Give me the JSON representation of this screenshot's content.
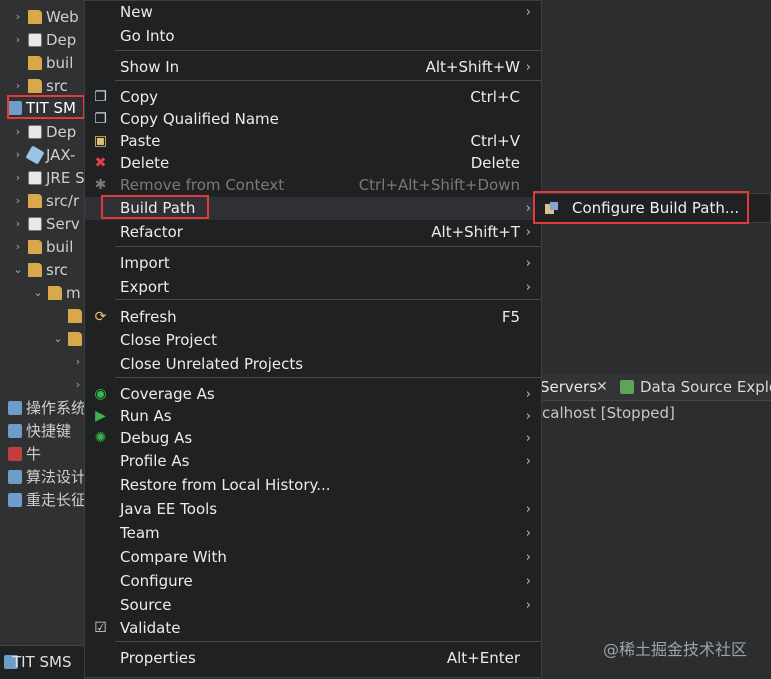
{
  "tree": {
    "items": [
      {
        "label": "Web",
        "arrow": "›",
        "icon": "folder-icon",
        "indent": 0
      },
      {
        "label": "Dep",
        "arrow": "›",
        "icon": "library-icon",
        "indent": 0
      },
      {
        "label": "buil",
        "arrow": "",
        "icon": "folder-icon",
        "indent": 0
      },
      {
        "label": "src",
        "arrow": "›",
        "icon": "folder-icon",
        "indent": 0
      },
      {
        "label": "TIT SM",
        "arrow": "⌄",
        "icon": "project-icon",
        "indent": -1,
        "selected": true
      },
      {
        "label": "Dep",
        "arrow": "›",
        "icon": "library-icon",
        "indent": 0
      },
      {
        "label": "JAX-",
        "arrow": "›",
        "icon": "jar-icon",
        "indent": 0
      },
      {
        "label": "JRE S",
        "arrow": "›",
        "icon": "library-icon",
        "indent": 0
      },
      {
        "label": "src/r",
        "arrow": "›",
        "icon": "folder-icon",
        "indent": 0
      },
      {
        "label": "Serv",
        "arrow": "›",
        "icon": "library-icon",
        "indent": 0
      },
      {
        "label": "buil",
        "arrow": "›",
        "icon": "folder-icon",
        "indent": 0
      },
      {
        "label": "src",
        "arrow": "⌄",
        "icon": "folder-icon",
        "indent": 0
      },
      {
        "label": "m",
        "arrow": "⌄",
        "icon": "folder-icon",
        "indent": 1
      },
      {
        "label": "",
        "arrow": "",
        "icon": "folder-icon",
        "indent": 2
      },
      {
        "label": "",
        "arrow": "⌄",
        "icon": "folder-icon",
        "indent": 2
      },
      {
        "label": "",
        "arrow": "›",
        "icon": "",
        "indent": 3
      },
      {
        "label": "",
        "arrow": "›",
        "icon": "",
        "indent": 3
      },
      {
        "label": "操作系统",
        "arrow": "›",
        "icon": "project-icon",
        "indent": -1
      },
      {
        "label": "快捷键",
        "arrow": "›",
        "icon": "project-icon",
        "indent": -1
      },
      {
        "label": "牛",
        "arrow": "›",
        "icon": "project-red-icon",
        "indent": -1
      },
      {
        "label": "算法设计",
        "arrow": "›",
        "icon": "project-icon",
        "indent": -1
      },
      {
        "label": "重走长征",
        "arrow": "›",
        "icon": "project-icon",
        "indent": -1
      }
    ]
  },
  "bottom_strip": {
    "label": "TIT SMS"
  },
  "context_menu": {
    "items": [
      {
        "label": "New",
        "shortcut": "",
        "submenu": true,
        "icon": ""
      },
      {
        "label": "Go Into",
        "shortcut": "",
        "submenu": false,
        "icon": ""
      },
      {
        "separator": true
      },
      {
        "label": "Show In",
        "shortcut": "Alt+Shift+W",
        "submenu": true,
        "icon": ""
      },
      {
        "separator": true
      },
      {
        "label": "Copy",
        "shortcut": "Ctrl+C",
        "submenu": false,
        "icon": "copy-icon"
      },
      {
        "label": "Copy Qualified Name",
        "shortcut": "",
        "submenu": false,
        "icon": "copy-qualified-icon"
      },
      {
        "label": "Paste",
        "shortcut": "Ctrl+V",
        "submenu": false,
        "icon": "paste-icon"
      },
      {
        "label": "Delete",
        "shortcut": "Delete",
        "submenu": false,
        "icon": "delete-icon"
      },
      {
        "label": "Remove from Context",
        "shortcut": "Ctrl+Alt+Shift+Down",
        "submenu": false,
        "icon": "remove-context-icon",
        "disabled": true
      },
      {
        "label": "Build Path",
        "shortcut": "",
        "submenu": true,
        "icon": "",
        "hover": true
      },
      {
        "label": "Refactor",
        "shortcut": "Alt+Shift+T",
        "submenu": true,
        "icon": ""
      },
      {
        "separator": true
      },
      {
        "label": "Import",
        "shortcut": "",
        "submenu": true,
        "icon": ""
      },
      {
        "label": "Export",
        "shortcut": "",
        "submenu": true,
        "icon": ""
      },
      {
        "separator": true
      },
      {
        "label": "Refresh",
        "shortcut": "F5",
        "submenu": false,
        "icon": "refresh-icon"
      },
      {
        "label": "Close Project",
        "shortcut": "",
        "submenu": false,
        "icon": ""
      },
      {
        "label": "Close Unrelated Projects",
        "shortcut": "",
        "submenu": false,
        "icon": ""
      },
      {
        "separator": true
      },
      {
        "label": "Coverage As",
        "shortcut": "",
        "submenu": true,
        "icon": "coverage-icon"
      },
      {
        "label": "Run As",
        "shortcut": "",
        "submenu": true,
        "icon": "run-icon"
      },
      {
        "label": "Debug As",
        "shortcut": "",
        "submenu": true,
        "icon": "debug-icon"
      },
      {
        "label": "Profile As",
        "shortcut": "",
        "submenu": true,
        "icon": ""
      },
      {
        "label": "Restore from Local History...",
        "shortcut": "",
        "submenu": false,
        "icon": ""
      },
      {
        "label": "Java EE Tools",
        "shortcut": "",
        "submenu": true,
        "icon": ""
      },
      {
        "label": "Team",
        "shortcut": "",
        "submenu": true,
        "icon": ""
      },
      {
        "label": "Compare With",
        "shortcut": "",
        "submenu": true,
        "icon": ""
      },
      {
        "label": "Configure",
        "shortcut": "",
        "submenu": true,
        "icon": ""
      },
      {
        "label": "Source",
        "shortcut": "",
        "submenu": true,
        "icon": ""
      },
      {
        "label": "Validate",
        "shortcut": "",
        "submenu": false,
        "icon": "check-icon"
      },
      {
        "separator": true
      },
      {
        "label": "Properties",
        "shortcut": "Alt+Enter",
        "submenu": false,
        "icon": ""
      }
    ]
  },
  "submenu": {
    "items": [
      {
        "label": "Configure Build Path...",
        "icon": "build-path-icon"
      }
    ]
  },
  "background": {
    "tabs": {
      "servers": "Servers",
      "close": "✕",
      "data_source": "Data Source Explo"
    },
    "server_status": "calhost  [Stopped]"
  },
  "watermark": "@稀土掘金技术社区",
  "colors": {
    "menu_bg": "#1f2122",
    "highlight_box": "#e23a3a",
    "tree_bg": "#2f3133"
  }
}
